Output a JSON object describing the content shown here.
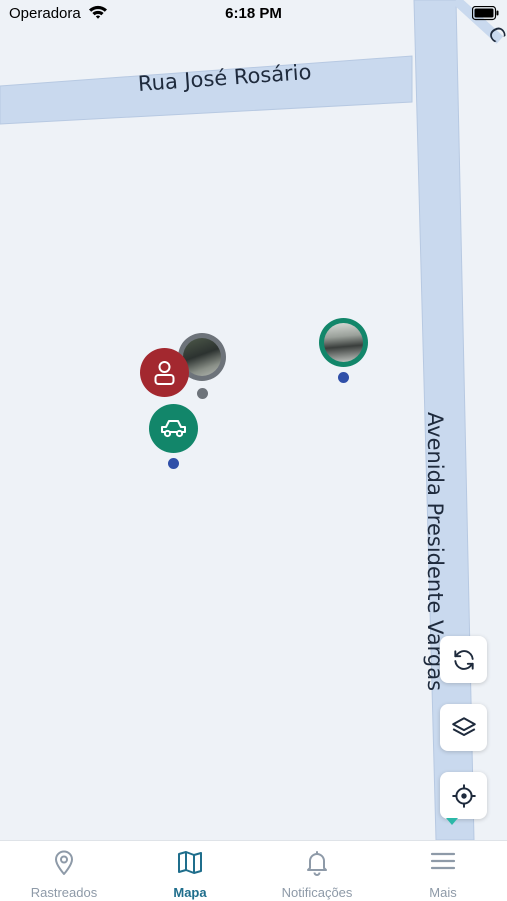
{
  "status_bar": {
    "carrier": "Operadora",
    "time": "6:18 PM"
  },
  "map": {
    "streets": [
      "Rua José Rosário",
      "Avenida Presidente Vargas"
    ],
    "corner_label": "C"
  },
  "markers": [
    {
      "name": "person-marker",
      "color": "#a3282f",
      "icon": "person-icon"
    },
    {
      "name": "car-marker",
      "color": "#12866a",
      "icon": "car-icon"
    },
    {
      "name": "vehicle-photo-marker-gray",
      "color": "#6d737a",
      "icon": "vehicle-photo"
    },
    {
      "name": "vehicle-photo-marker-green",
      "color": "#12866a",
      "icon": "vehicle-photo"
    }
  ],
  "map_controls": [
    "refresh-icon",
    "layers-icon",
    "locate-icon"
  ],
  "tabs": [
    {
      "label": "Rastreados",
      "icon": "location-pin-icon",
      "active": false
    },
    {
      "label": "Mapa",
      "icon": "map-icon",
      "active": true
    },
    {
      "label": "Notificações",
      "icon": "bell-icon",
      "active": false
    },
    {
      "label": "Mais",
      "icon": "menu-icon",
      "active": false
    }
  ],
  "colors": {
    "accent": "#1f6e8c",
    "road": "#c9d9ee",
    "dot_blue": "#2f4fa8"
  }
}
